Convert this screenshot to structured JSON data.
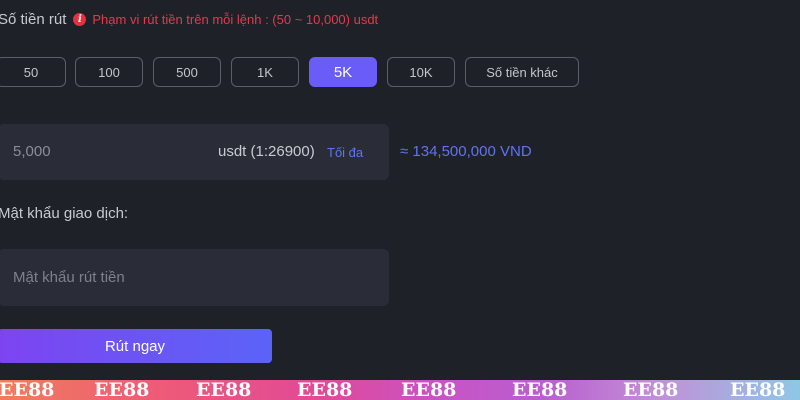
{
  "amount_section": {
    "label": "Số tiền rút",
    "range_hint": "Phạm vi rút tiền trên mỗi lệnh : (50 ~ 10,000) usdt"
  },
  "quick_amounts": [
    {
      "label": "50",
      "selected": false
    },
    {
      "label": "100",
      "selected": false
    },
    {
      "label": "500",
      "selected": false
    },
    {
      "label": "1K",
      "selected": false
    },
    {
      "label": "5K",
      "selected": true
    },
    {
      "label": "10K",
      "selected": false
    },
    {
      "label": "Số tiền khác",
      "selected": false
    }
  ],
  "amount_input": {
    "value": "5,000",
    "currency": "usdt (1:26900)",
    "max_label": "Tối đa",
    "converted": "≈ 134,500,000 VND"
  },
  "password": {
    "label": "Mật khẩu giao dịch:",
    "placeholder": "Mật khẩu rút tiền"
  },
  "submit": {
    "label": "Rút ngay"
  },
  "brand": {
    "text": "EE88"
  },
  "colors": {
    "accent": "#6a5cf6",
    "error": "#e33a4b",
    "link": "#5b76f0",
    "background": "#1f2129",
    "field": "#2a2d37"
  }
}
